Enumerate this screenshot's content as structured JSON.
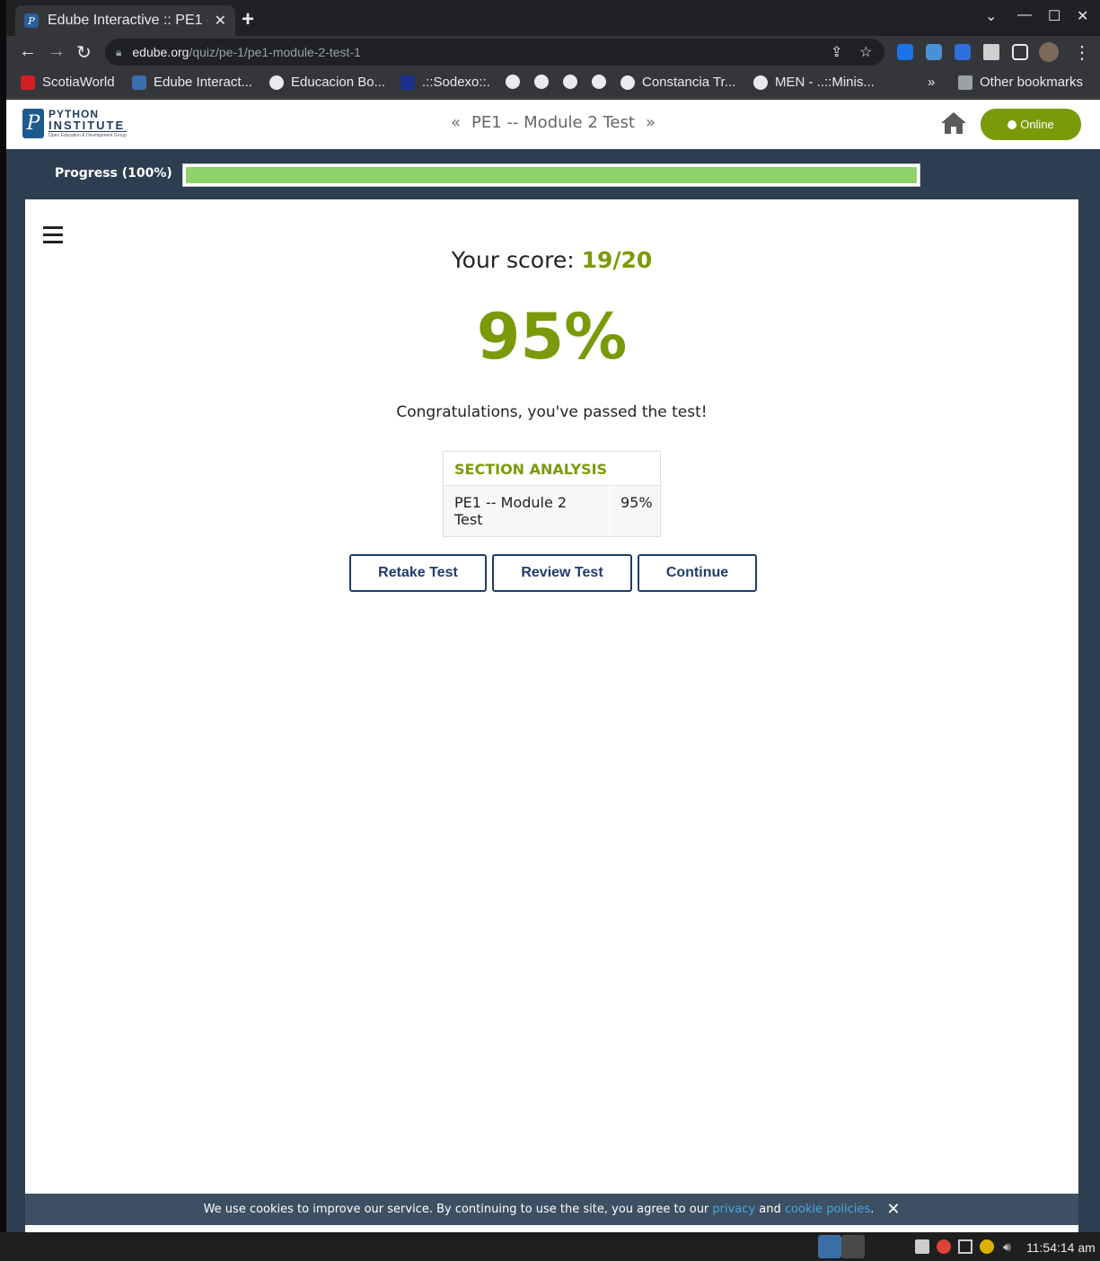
{
  "browser": {
    "tab_title": "Edube Interactive :: PE1 -- Module 2 Test",
    "url_domain": "edube.org",
    "url_path": "/quiz/pe-1/pe1-module-2-test-1",
    "bookmarks": [
      {
        "label": "ScotiaWorld"
      },
      {
        "label": "Edube Interact..."
      },
      {
        "label": "Educacion Bo..."
      },
      {
        "label": ".::Sodexo::."
      },
      {
        "label": "Constancia Tr..."
      },
      {
        "label": "MEN - ..::Minis..."
      }
    ],
    "other_bookmarks": "Other bookmarks",
    "overflow_label": "»"
  },
  "site": {
    "logo_line1": "PYTHON",
    "logo_line2": "INSTITUTE",
    "logo_line3": "Open Education & Development Group",
    "breadcrumb": "PE1 -- Module 2 Test",
    "online_label": "Online",
    "accent_color": "#7a9a0a"
  },
  "progress": {
    "label": "Progress (100%)",
    "value": 1.0
  },
  "result": {
    "score_prefix": "Your score:",
    "score_value": "19/20",
    "percent": "95%",
    "message": "Congratulations, you've passed the test!",
    "analysis_title": "SECTION ANALYSIS",
    "analysis_rows": [
      {
        "name": "PE1 -- Module 2 Test",
        "value": "95%"
      }
    ]
  },
  "actions": {
    "retake": "Retake Test",
    "review": "Review Test",
    "continue": "Continue"
  },
  "cookie": {
    "text_before": "We use cookies to improve our service. By continuing to use the site, you agree to our",
    "privacy": "privacy",
    "and": "and",
    "cookie_policies": "cookie policies",
    "period": "."
  },
  "taskbar": {
    "clock": "11:54:14 am"
  }
}
